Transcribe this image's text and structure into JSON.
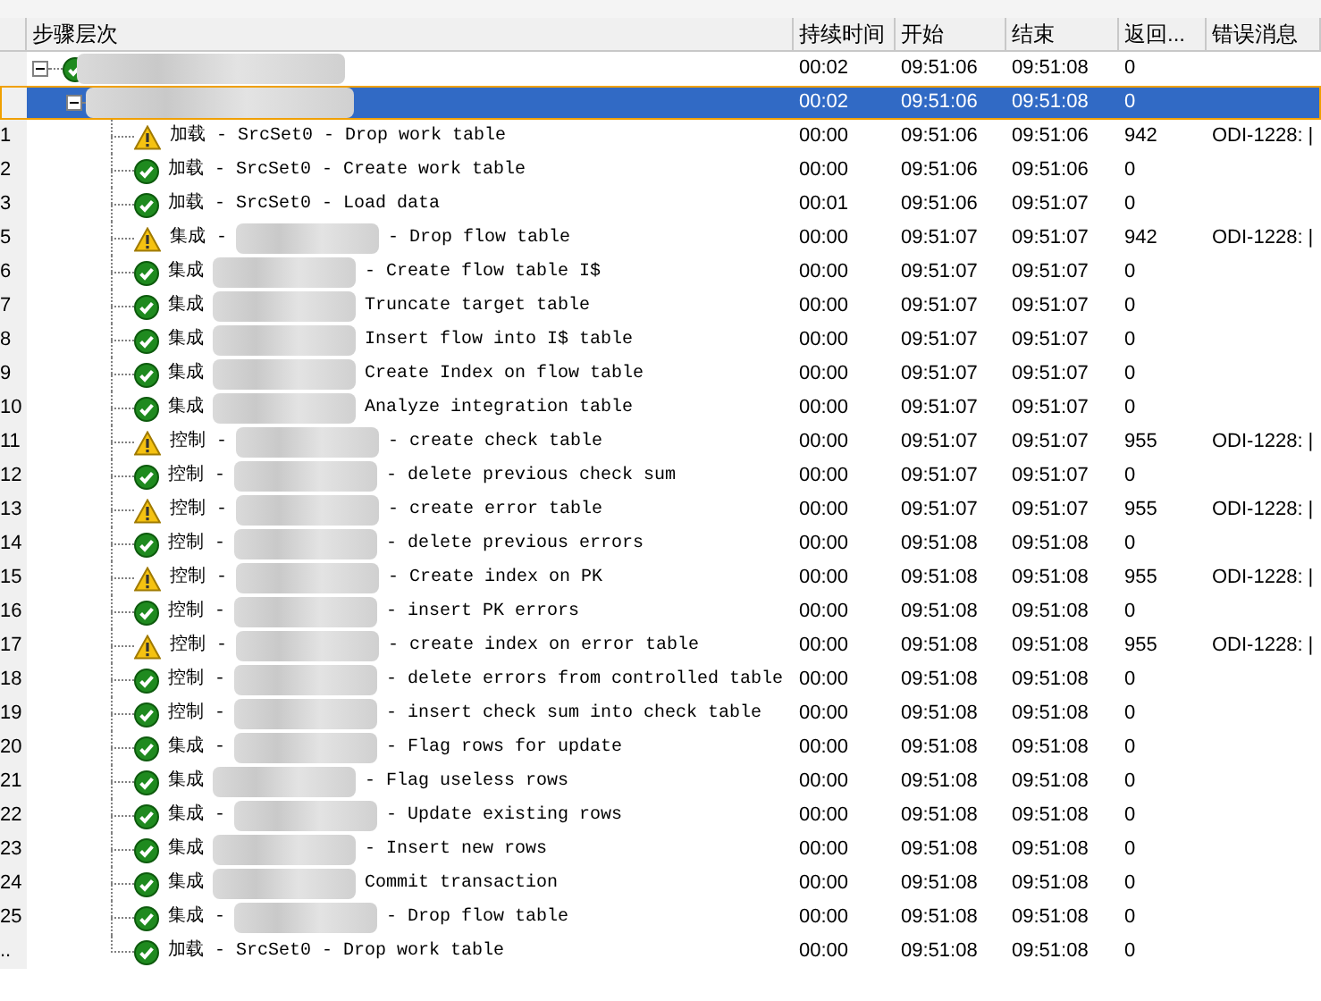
{
  "columns": [
    "步骤层次",
    "持续时间",
    "开始",
    "结束",
    "返回...",
    "错误消息"
  ],
  "tree": [
    {
      "expanded": true,
      "selected": false,
      "warning": false,
      "redacted": true,
      "duration": "00:02",
      "start": "09:51:06",
      "end": "09:51:08",
      "return": "0",
      "children": [
        {
          "expanded": true,
          "selected": true,
          "redacted": true,
          "duration": "00:02",
          "start": "09:51:06",
          "end": "09:51:08",
          "return": "0",
          "children": [
            {
              "number": "1",
              "selected": false,
              "warning": true,
              "redacted": false,
              "label": "加载 - SrcSet0 - Drop work table",
              "duration": "00:00",
              "start": "09:51:06",
              "end": "09:51:06",
              "return": "942",
              "error": "ODI-1228: |"
            },
            {
              "number": "2",
              "selected": false,
              "warning": false,
              "redacted": false,
              "label": "加载 - SrcSet0 - Create work table",
              "duration": "00:00",
              "start": "09:51:06",
              "end": "09:51:06",
              "return": "0"
            },
            {
              "number": "3",
              "selected": false,
              "warning": false,
              "redacted": false,
              "label": "加载 - SrcSet0 - Load data",
              "duration": "00:01",
              "start": "09:51:06",
              "end": "09:51:07",
              "return": "0"
            },
            {
              "number": "5",
              "selected": false,
              "warning": true,
              "redacted": true,
              "label": "集成 -",
              "label_end": "- Drop flow table",
              "duration": "00:00",
              "start": "09:51:07",
              "end": "09:51:07",
              "return": "942",
              "error": "ODI-1228: |"
            },
            {
              "number": "6",
              "selected": false,
              "warning": false,
              "redacted": true,
              "label": "集成",
              "label_end": "- Create flow table I$",
              "duration": "00:00",
              "start": "09:51:07",
              "end": "09:51:07",
              "return": "0"
            },
            {
              "number": "7",
              "selected": false,
              "warning": false,
              "redacted": true,
              "label": "集成",
              "label_end": "Truncate target table",
              "duration": "00:00",
              "start": "09:51:07",
              "end": "09:51:07",
              "return": "0"
            },
            {
              "number": "8",
              "selected": false,
              "warning": false,
              "redacted": true,
              "label": "集成",
              "label_end": "Insert flow into I$ table",
              "duration": "00:00",
              "start": "09:51:07",
              "end": "09:51:07",
              "return": "0"
            },
            {
              "number": "9",
              "selected": false,
              "warning": false,
              "redacted": true,
              "label": "集成",
              "label_end": "Create Index on flow table",
              "duration": "00:00",
              "start": "09:51:07",
              "end": "09:51:07",
              "return": "0"
            },
            {
              "number": "10",
              "selected": false,
              "warning": false,
              "redacted": true,
              "label": "集成",
              "label_end": "Analyze integration table",
              "duration": "00:00",
              "start": "09:51:07",
              "end": "09:51:07",
              "return": "0"
            },
            {
              "number": "11",
              "selected": false,
              "warning": true,
              "redacted": true,
              "label": "控制 -",
              "label_end": "- create check table",
              "duration": "00:00",
              "start": "09:51:07",
              "end": "09:51:07",
              "return": "955",
              "error": "ODI-1228: |"
            },
            {
              "number": "12",
              "selected": false,
              "warning": false,
              "redacted": true,
              "label": "控制 -",
              "label_end": "- delete previous check sum",
              "duration": "00:00",
              "start": "09:51:07",
              "end": "09:51:07",
              "return": "0"
            },
            {
              "number": "13",
              "selected": false,
              "warning": true,
              "redacted": true,
              "label": "控制 -",
              "label_end": "- create error table",
              "duration": "00:00",
              "start": "09:51:07",
              "end": "09:51:07",
              "return": "955",
              "error": "ODI-1228: |"
            },
            {
              "number": "14",
              "selected": false,
              "warning": false,
              "redacted": true,
              "label": "控制 -",
              "label_end": "- delete previous errors",
              "duration": "00:00",
              "start": "09:51:08",
              "end": "09:51:08",
              "return": "0"
            },
            {
              "number": "15",
              "selected": false,
              "warning": true,
              "redacted": true,
              "label": "控制 -",
              "label_end": "- Create index on PK",
              "duration": "00:00",
              "start": "09:51:08",
              "end": "09:51:08",
              "return": "955",
              "error": "ODI-1228: |"
            },
            {
              "number": "16",
              "selected": false,
              "warning": false,
              "redacted": true,
              "label": "控制 -",
              "label_end": "- insert PK errors",
              "duration": "00:00",
              "start": "09:51:08",
              "end": "09:51:08",
              "return": "0"
            },
            {
              "number": "17",
              "selected": false,
              "warning": true,
              "redacted": true,
              "label": "控制 -",
              "label_end": "- create index on error table",
              "duration": "00:00",
              "start": "09:51:08",
              "end": "09:51:08",
              "return": "955",
              "error": "ODI-1228: |"
            },
            {
              "number": "18",
              "selected": false,
              "warning": false,
              "redacted": true,
              "label": "控制 -",
              "label_end": "- delete errors from controlled table",
              "duration": "00:00",
              "start": "09:51:08",
              "end": "09:51:08",
              "return": "0"
            },
            {
              "number": "19",
              "selected": false,
              "warning": false,
              "redacted": true,
              "label": "控制 -",
              "label_end": "- insert check sum into check table",
              "duration": "00:00",
              "start": "09:51:08",
              "end": "09:51:08",
              "return": "0"
            },
            {
              "number": "20",
              "selected": false,
              "warning": false,
              "redacted": true,
              "label": "集成 -",
              "label_end": "- Flag rows for update",
              "duration": "00:00",
              "start": "09:51:08",
              "end": "09:51:08",
              "return": "0"
            },
            {
              "number": "21",
              "selected": false,
              "warning": false,
              "redacted": true,
              "label": "集成",
              "label_end": "- Flag useless rows",
              "duration": "00:00",
              "start": "09:51:08",
              "end": "09:51:08",
              "return": "0"
            },
            {
              "number": "22",
              "selected": false,
              "warning": false,
              "redacted": true,
              "label": "集成 -",
              "label_end": "- Update existing rows",
              "duration": "00:00",
              "start": "09:51:08",
              "end": "09:51:08",
              "return": "0"
            },
            {
              "number": "23",
              "selected": false,
              "warning": false,
              "redacted": true,
              "label": "集成",
              "label_end": "- Insert new rows",
              "duration": "00:00",
              "start": "09:51:08",
              "end": "09:51:08",
              "return": "0"
            },
            {
              "number": "24",
              "selected": false,
              "warning": false,
              "redacted": true,
              "label": "集成",
              "label_end": "Commit transaction",
              "duration": "00:00",
              "start": "09:51:08",
              "end": "09:51:08",
              "return": "0"
            },
            {
              "number": "25",
              "selected": false,
              "warning": false,
              "redacted": true,
              "label": "集成 -",
              "label_end": "- Drop flow table",
              "duration": "00:00",
              "start": "09:51:08",
              "end": "09:51:08",
              "return": "0"
            },
            {
              "number": "..",
              "selected": false,
              "warning": false,
              "redacted": false,
              "label": "加载 - SrcSet0 - Drop work table",
              "duration": "00:00",
              "start": "09:51:08",
              "end": "09:51:08",
              "return": "0"
            }
          ]
        }
      ]
    }
  ]
}
